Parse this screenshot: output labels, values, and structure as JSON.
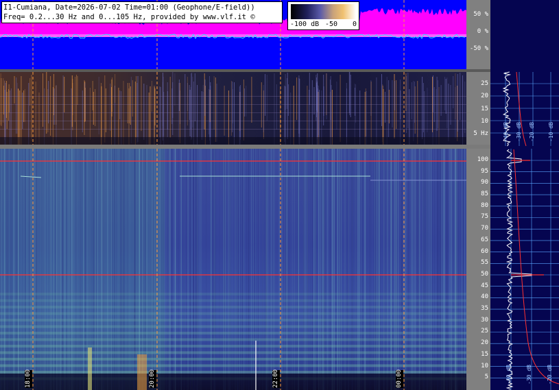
{
  "header": {
    "line1": "I1-Cumiana, Date=2026-07-02 Time=01:00 (Geophone/E-field))",
    "line2": "Freq= 0.2...30 Hz and 0...105 Hz, provided by www.vlf.it ©"
  },
  "legend": {
    "min_label": "-100 dB",
    "mid_label": "-50",
    "max_label": "0"
  },
  "amplitude_scale": {
    "ticks": [
      "50 %",
      "0 %",
      "-50 %"
    ]
  },
  "lowfreq_scale": {
    "ticks": [
      "25",
      "20",
      "15",
      "10",
      "5 Hz"
    ]
  },
  "main_scale": {
    "ticks": [
      "100",
      "95",
      "90",
      "85",
      "80",
      "75",
      "70",
      "65",
      "60",
      "55",
      "50",
      "45",
      "40",
      "35",
      "30",
      "25",
      "20",
      "15",
      "10",
      "5"
    ]
  },
  "time_axis": {
    "labels": [
      "18:00",
      "20:00",
      "22:00",
      "00:00"
    ]
  },
  "profile_db_labels": {
    "upper": [
      "-40 dB",
      "-30 dB",
      "-20 dB",
      "-10 dB"
    ],
    "lower": [
      "-40 dB",
      "-30 dB",
      "-20 dB"
    ]
  },
  "colors": {
    "accent_magenta": "#ff00ff",
    "amp_blue": "#0000ff",
    "marker_red": "#ff3030",
    "cursor_orange": "#ff9a3a",
    "profile_white": "#ffffff",
    "grid_cyan": "#5aa8ff"
  }
}
